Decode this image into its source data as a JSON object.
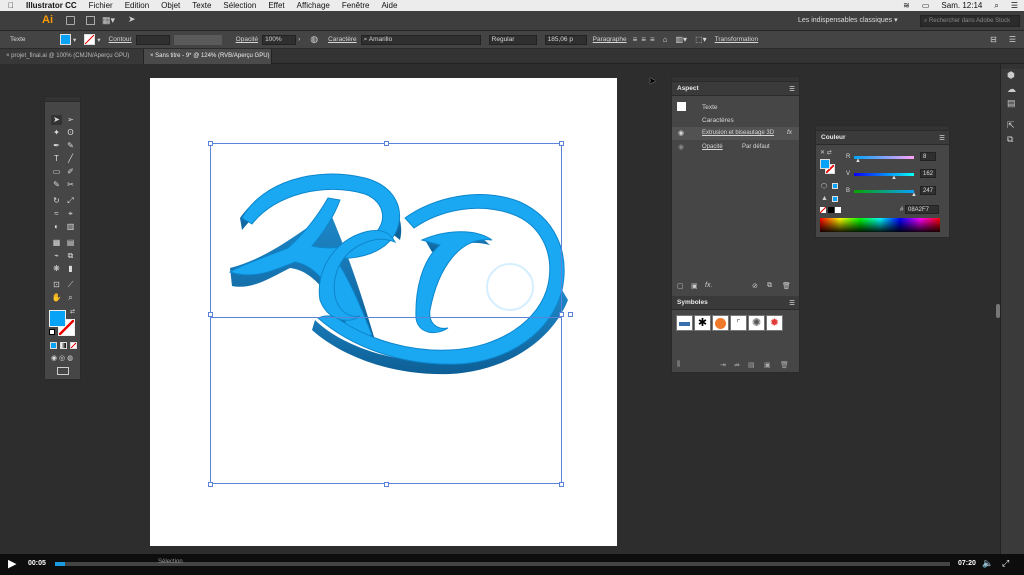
{
  "menubar": {
    "apple": "",
    "app": "Illustrator CC",
    "items": [
      "Fichier",
      "Edition",
      "Objet",
      "Texte",
      "Sélection",
      "Effet",
      "Affichage",
      "Fenêtre",
      "Aide"
    ],
    "clock": "Sam. 12:14"
  },
  "appbar": {
    "logo": "Ai",
    "workspace": "Les indispensables classiques",
    "search_placeholder": "Rechercher dans Adobe Stock"
  },
  "control": {
    "type_label": "Texte",
    "stroke_label": "Contour",
    "opacity_label": "Opacité",
    "opacity_value": "100%",
    "char_label": "Caractère",
    "font": "Amarillo",
    "style": "Regular",
    "size": "185,06 p",
    "para_label": "Paragraphe",
    "transform_label": "Transformation"
  },
  "tabs": [
    "projet_final.ai @ 100% (CMJN/Aperçu GPU)",
    "Sans titre - 9* @ 124% (RVB/Aperçu GPU)"
  ],
  "artwork": {
    "text": "RD"
  },
  "aspect": {
    "title": "Aspect",
    "rows": [
      "Texte",
      "Caractères",
      "Extrusion et biseautage 3D",
      "Opacité"
    ],
    "opacity_value": "Par défaut",
    "fx": "fx"
  },
  "symboles": {
    "title": "Symboles"
  },
  "couleur": {
    "title": "Couleur",
    "r_label": "R",
    "v_label": "V",
    "b_label": "B",
    "r": "8",
    "v": "162",
    "b": "247",
    "hex_prefix": "#",
    "hex": "08A2F7"
  },
  "accent": "#08A2F7",
  "video": {
    "current": "00:05",
    "total": "07:20",
    "status": "Sélection",
    "progress": 0.011
  }
}
